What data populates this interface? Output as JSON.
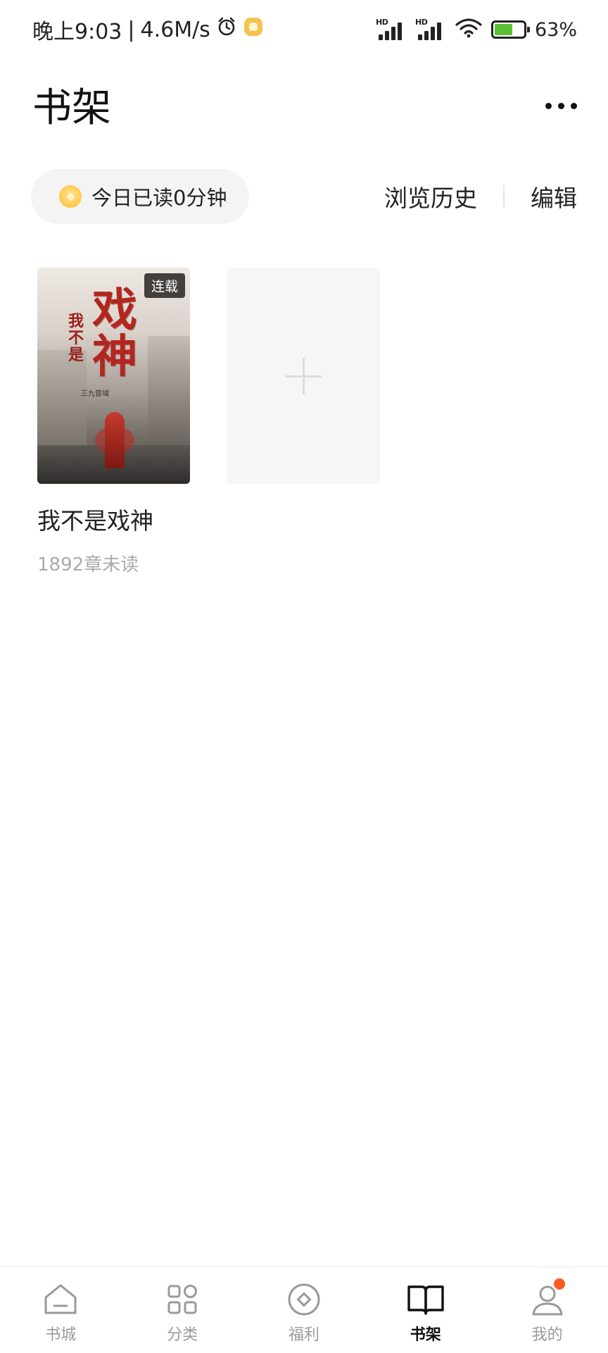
{
  "status": {
    "time": "晚上9:03",
    "separator": "|",
    "speed": "4.6M/s",
    "signal_label": "HD",
    "battery": "63%",
    "battery_level": 0.63
  },
  "header": {
    "title": "书架"
  },
  "reading": {
    "label": "今日已读0分钟"
  },
  "links": {
    "history": "浏览历史",
    "edit": "编辑"
  },
  "books": [
    {
      "title": "我不是戏神",
      "unread": "1892章未读",
      "badge": "连载",
      "cover_title_small": "我不是",
      "cover_title_large": "戏神",
      "cover_author": "三九音域"
    }
  ],
  "tabs": [
    {
      "label": "书城",
      "icon": "home-icon"
    },
    {
      "label": "分类",
      "icon": "category-grid-icon"
    },
    {
      "label": "福利",
      "icon": "coin-icon"
    },
    {
      "label": "书架",
      "icon": "open-book-icon",
      "active": true
    },
    {
      "label": "我的",
      "icon": "user-icon",
      "has_dot": true
    }
  ],
  "colors": {
    "accent_dot": "#ff5a1f",
    "coin": "#ffcf55",
    "battery_fill": "#5bbf33"
  }
}
